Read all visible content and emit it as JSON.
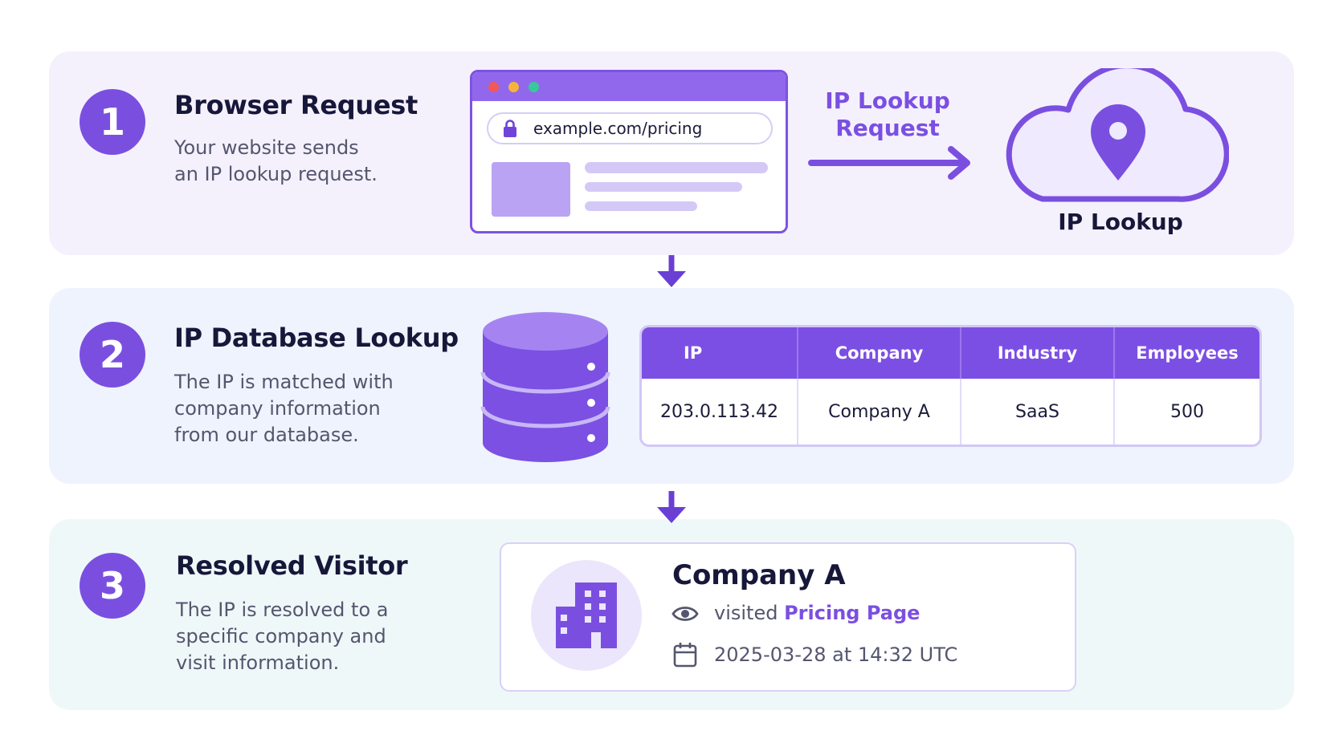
{
  "steps": [
    {
      "number": "1",
      "title": "Browser Request",
      "desc": [
        "Your website sends",
        "an IP lookup request."
      ]
    },
    {
      "number": "2",
      "title": "IP Database Lookup",
      "desc": [
        "The IP is matched with",
        "company information",
        "from our database."
      ]
    },
    {
      "number": "3",
      "title": "Resolved Visitor",
      "desc": [
        "The IP is resolved to a",
        "specific company and",
        "visit information."
      ]
    }
  ],
  "browser": {
    "url": "example.com/pricing",
    "icon": "lock-icon"
  },
  "lookup_request": [
    "IP Lookup",
    "Request"
  ],
  "cloud": {
    "label": "IP Lookup",
    "icon": "location-pin-icon"
  },
  "table": {
    "headers": [
      "IP",
      "Company",
      "Industry",
      "Employees"
    ],
    "row": [
      "203.0.113.42",
      "Company A",
      "SaaS",
      "500"
    ]
  },
  "visitor": {
    "company": "Company A",
    "visited_prefix": "visited",
    "visited_page": "Pricing Page",
    "time": "2025-03-28 at 14:32 UTC",
    "icons": [
      "building-icon",
      "eye-icon",
      "calendar-icon"
    ]
  },
  "colors": {
    "accent": "#7b4fe2",
    "panel1": "#f4f1fd",
    "panel2": "#eff3fd",
    "panel3": "#eff8f9"
  }
}
